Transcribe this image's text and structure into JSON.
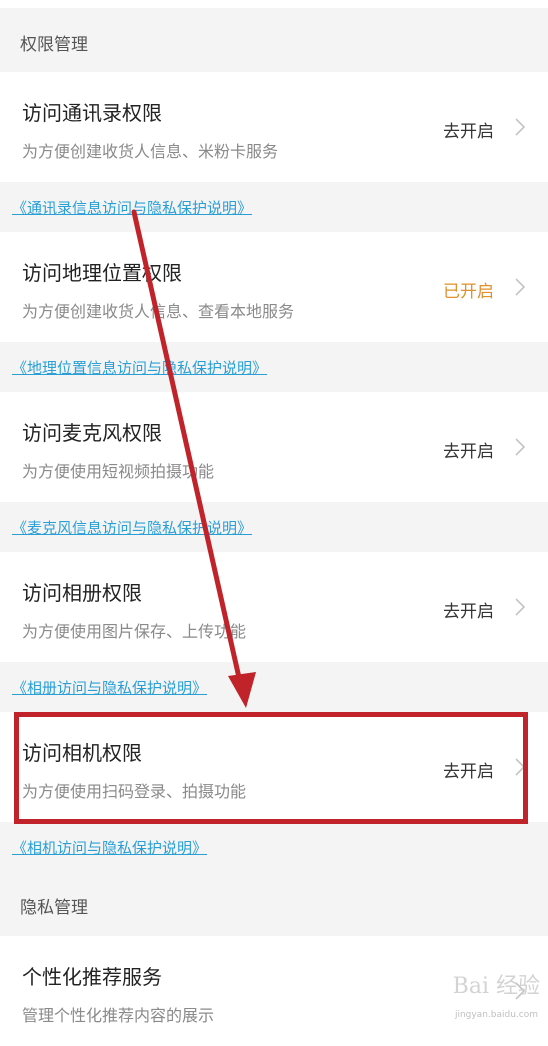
{
  "sections": {
    "permissions_title": "权限管理",
    "privacy_title": "隐私管理"
  },
  "rows": [
    {
      "title": "访问通讯录权限",
      "subtitle": "为方便创建收货人信息、米粉卡服务",
      "status": "去开启",
      "status_on": false
    },
    {
      "title": "访问地理位置权限",
      "subtitle": "为方便创建收货人信息、查看本地服务",
      "status": "已开启",
      "status_on": true
    },
    {
      "title": "访问麦克风权限",
      "subtitle": "为方便使用短视频拍摄功能",
      "status": "去开启",
      "status_on": false
    },
    {
      "title": "访问相册权限",
      "subtitle": "为方便使用图片保存、上传功能",
      "status": "去开启",
      "status_on": false
    },
    {
      "title": "访问相机权限",
      "subtitle": "为方便使用扫码登录、拍摄功能",
      "status": "去开启",
      "status_on": false
    }
  ],
  "links": [
    "《通讯录信息访问与隐私保护说明》",
    "《地理位置信息访问与隐私保护说明》",
    "《麦克风信息访问与隐私保护说明》",
    "《相册访问与隐私保护说明》",
    "《相机访问与隐私保护说明》"
  ],
  "privacy_row": {
    "title": "个性化推荐服务",
    "subtitle": "管理个性化推荐内容的展示"
  },
  "watermark": {
    "text": "Bai 经验",
    "sub": "jingyan.baidu.com"
  },
  "colors": {
    "status_on": "#e0902c",
    "link": "#2a9fd6",
    "highlight": "#c0232a"
  }
}
